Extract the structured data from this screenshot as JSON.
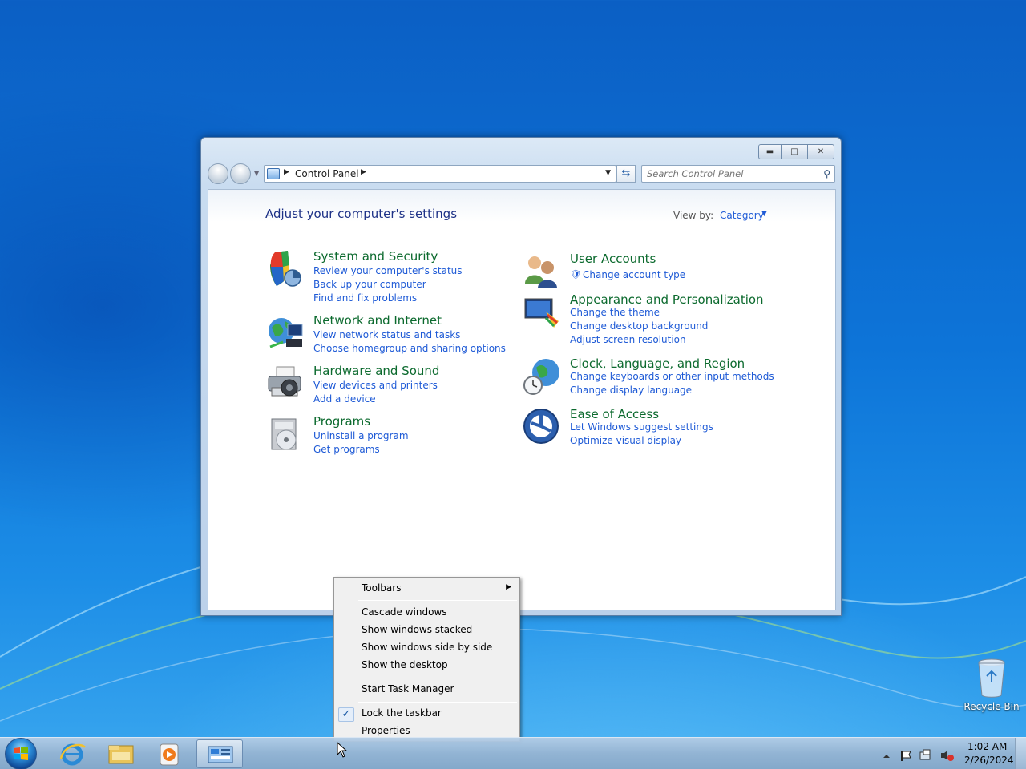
{
  "window": {
    "address_path": "Control Panel",
    "search_placeholder": "Search Control Panel",
    "heading": "Adjust your computer's settings",
    "view_by_label": "View by:",
    "view_by_value": "Category",
    "categories_left": [
      {
        "title": "System and Security",
        "links": [
          "Review your computer's status",
          "Back up your computer",
          "Find and fix problems"
        ]
      },
      {
        "title": "Network and Internet",
        "links": [
          "View network status and tasks",
          "Choose homegroup and sharing options"
        ]
      },
      {
        "title": "Hardware and Sound",
        "links": [
          "View devices and printers",
          "Add a device"
        ]
      },
      {
        "title": "Programs",
        "links": [
          "Uninstall a program",
          "Get programs"
        ]
      }
    ],
    "categories_right": [
      {
        "title": "User Accounts",
        "links": [
          "Change account type"
        ]
      },
      {
        "title": "Appearance and Personalization",
        "links": [
          "Change the theme",
          "Change desktop background",
          "Adjust screen resolution"
        ]
      },
      {
        "title": "Clock, Language, and Region",
        "links": [
          "Change keyboards or other input methods",
          "Change display language"
        ]
      },
      {
        "title": "Ease of Access",
        "links": [
          "Let Windows suggest settings",
          "Optimize visual display"
        ]
      }
    ]
  },
  "context_menu": {
    "toolbars": "Toolbars",
    "cascade": "Cascade windows",
    "stacked": "Show windows stacked",
    "side_by_side": "Show windows side by side",
    "show_desktop": "Show the desktop",
    "task_manager": "Start Task Manager",
    "lock_taskbar": "Lock the taskbar",
    "lock_taskbar_checked": true,
    "properties": "Properties"
  },
  "desktop": {
    "recycle_bin_label": "Recycle Bin"
  },
  "taskbar": {
    "time": "1:02 AM",
    "date": "2/26/2024"
  },
  "colors": {
    "category_title": "#0c6a2e",
    "link": "#1e5ad6",
    "heading": "#1e3287"
  }
}
